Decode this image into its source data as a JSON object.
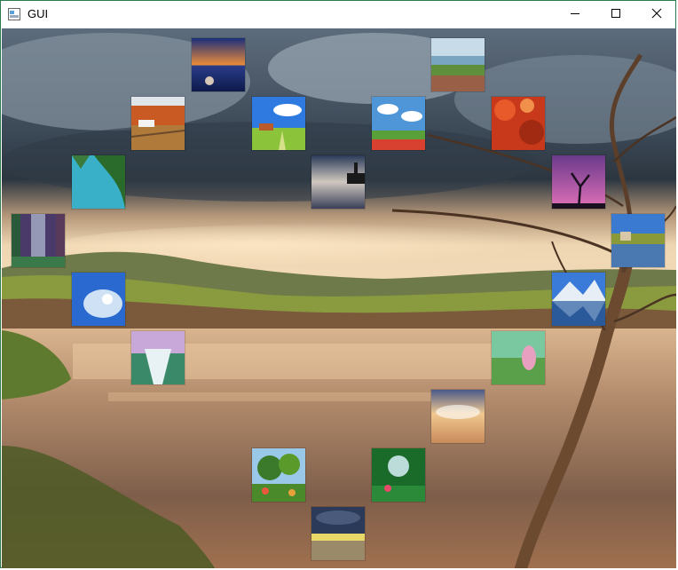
{
  "window": {
    "title": "GUI",
    "icons": {
      "app": "window-app-icon",
      "minimize": "minimize-icon",
      "maximize": "maximize-icon",
      "close": "close-icon"
    },
    "accent": "#2f7a4c"
  },
  "background": {
    "description_icon": "landscape-background-image"
  },
  "thumbnails": [
    {
      "name": "thumbnail-lake-sunset"
    },
    {
      "name": "thumbnail-meadow-lake"
    },
    {
      "name": "thumbnail-autumn-farm"
    },
    {
      "name": "thumbnail-green-field"
    },
    {
      "name": "thumbnail-blue-sky-flowers"
    },
    {
      "name": "thumbnail-red-maple"
    },
    {
      "name": "thumbnail-turquoise-lake"
    },
    {
      "name": "thumbnail-pier-dusk"
    },
    {
      "name": "thumbnail-purple-tree"
    },
    {
      "name": "thumbnail-fantasy-forest"
    },
    {
      "name": "thumbnail-river-village"
    },
    {
      "name": "thumbnail-sky-clouds"
    },
    {
      "name": "thumbnail-mountain-lake"
    },
    {
      "name": "thumbnail-waterfall"
    },
    {
      "name": "thumbnail-painted-landscape"
    },
    {
      "name": "thumbnail-sunset-clouds"
    },
    {
      "name": "thumbnail-forest-house"
    },
    {
      "name": "thumbnail-green-forest-light"
    },
    {
      "name": "thumbnail-storm-field"
    }
  ]
}
